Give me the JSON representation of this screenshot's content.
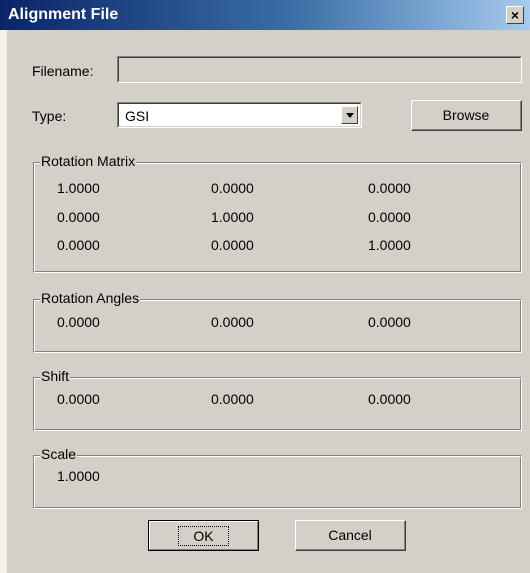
{
  "window": {
    "title": "Alignment File",
    "close_glyph": "×"
  },
  "form": {
    "filename_label": "Filename:",
    "filename_value": "",
    "type_label": "Type:",
    "type_value": "GSI",
    "browse_label": "Browse"
  },
  "rotation_matrix": {
    "title": "Rotation Matrix",
    "rows": [
      [
        "1.0000",
        "0.0000",
        "0.0000"
      ],
      [
        "0.0000",
        "1.0000",
        "0.0000"
      ],
      [
        "0.0000",
        "0.0000",
        "1.0000"
      ]
    ]
  },
  "rotation_angles": {
    "title": "Rotation Angles",
    "values": [
      "0.0000",
      "0.0000",
      "0.0000"
    ]
  },
  "shift": {
    "title": "Shift",
    "values": [
      "0.0000",
      "0.0000",
      "0.0000"
    ]
  },
  "scale": {
    "title": "Scale",
    "value": "1.0000"
  },
  "buttons": {
    "ok": "OK",
    "cancel": "Cancel"
  }
}
